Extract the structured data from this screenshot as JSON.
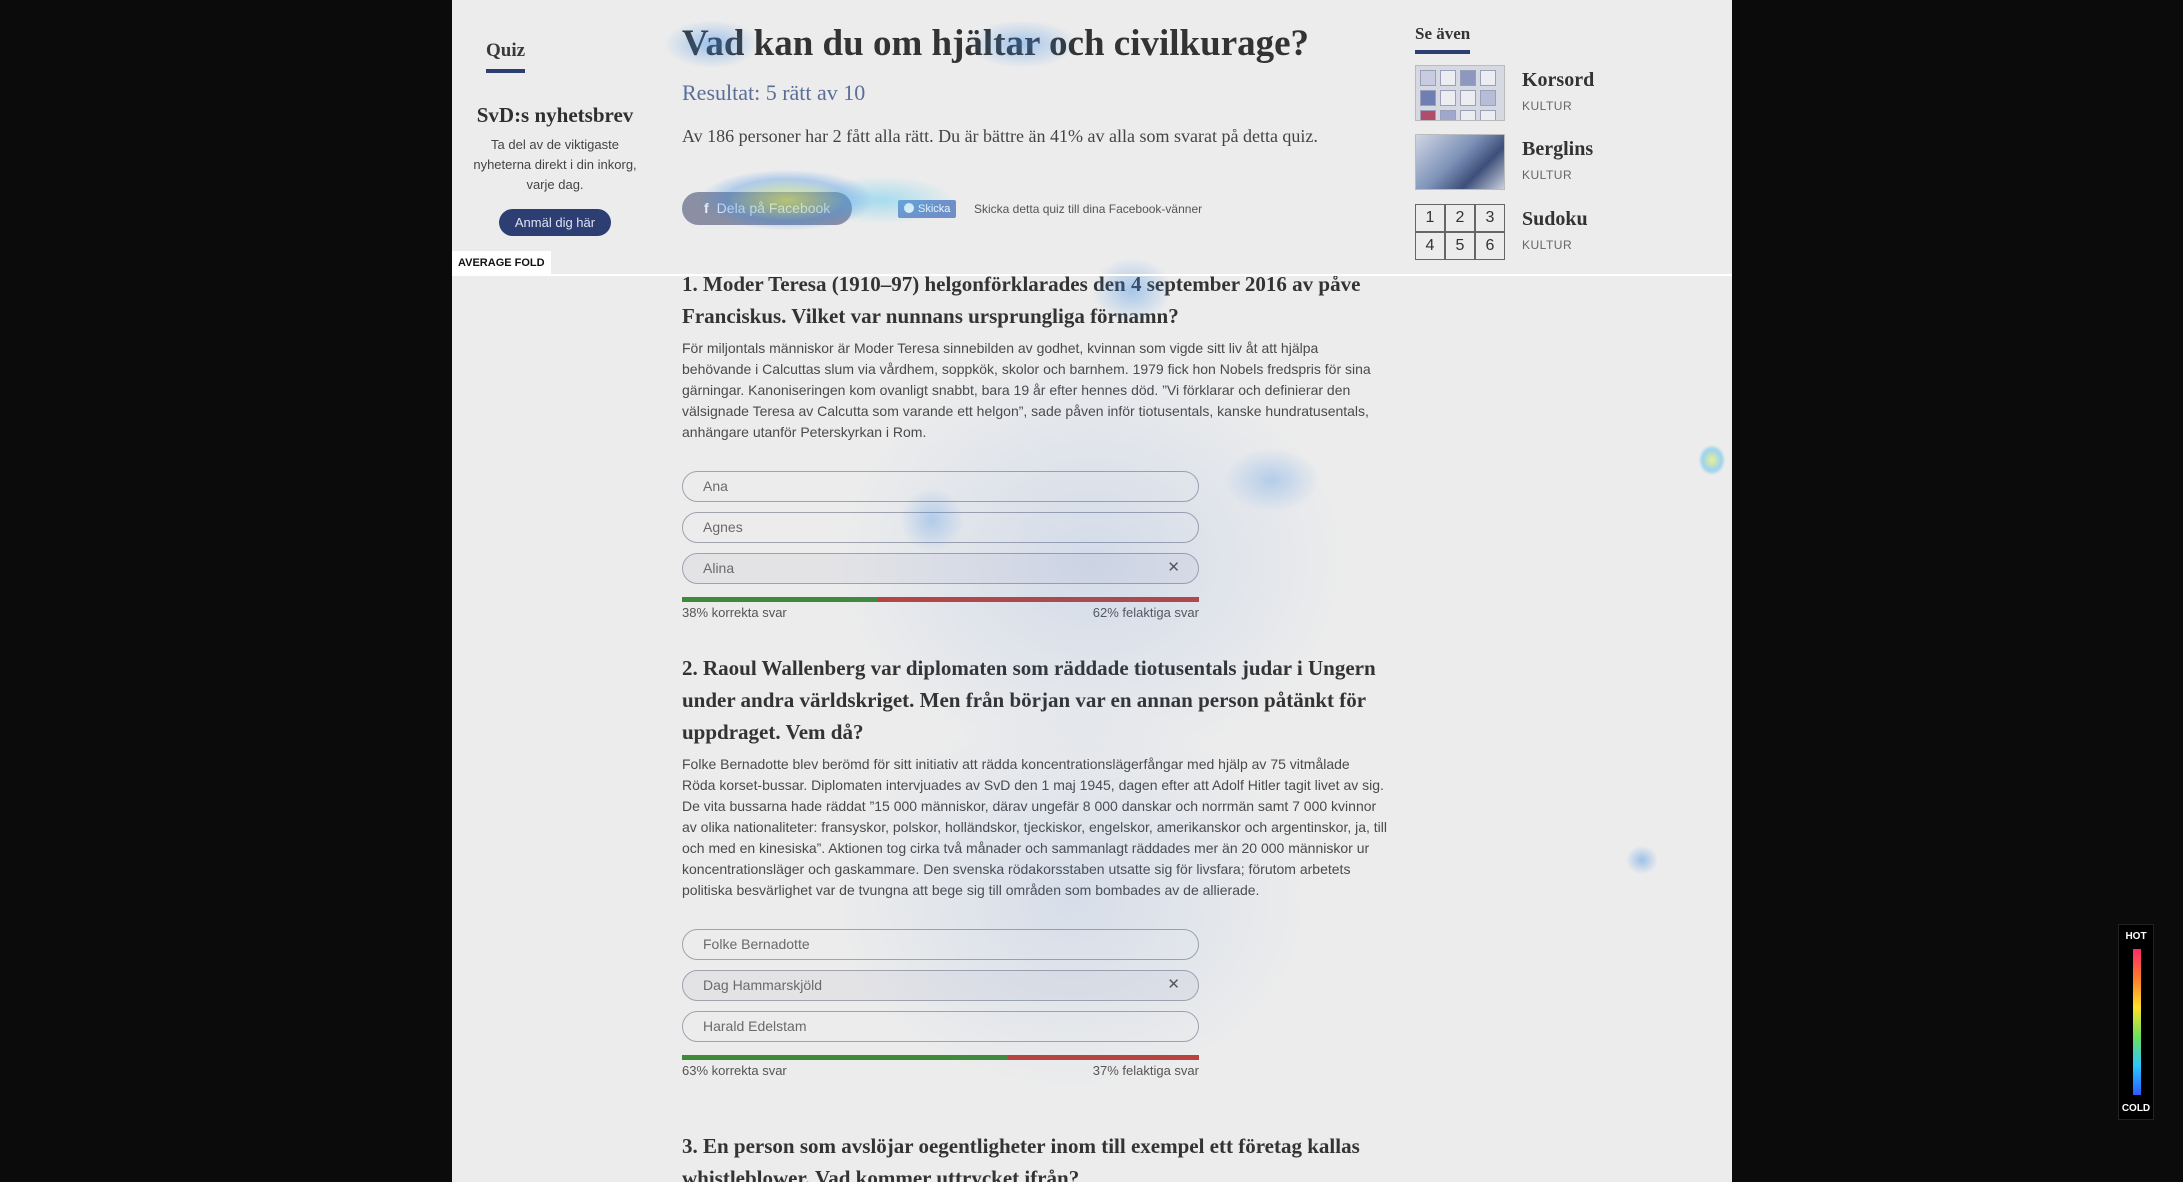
{
  "left": {
    "quiz_link": "Quiz",
    "newsletter": {
      "title": "SvD:s nyhetsbrev",
      "text": "Ta del av de viktigaste nyheterna direkt i din inkorg, varje dag.",
      "button": "Anmäl dig här"
    }
  },
  "main": {
    "title": "Vad kan du om hjältar och civilkurage?",
    "result": "Resultat: 5 rätt av 10",
    "summary": "Av 186 personer har 2 fått alla rätt. Du är bättre än 41% av alla som svarat på detta quiz.",
    "share": {
      "facebook_label": "Dela på Facebook",
      "facebook_icon": "f",
      "messenger_label": "Skicka",
      "messenger_text": "Skicka detta quiz till dina Facebook-vänner"
    },
    "questions": [
      {
        "title": "1. Moder Teresa (1910–97) helgonförklarades den 4 september 2016 av påve Franciskus. Vilket var nunnans ursprungliga förnamn?",
        "text": "För miljontals människor är Moder Teresa sinnebilden av godhet, kvinnan som vigde sitt liv åt att hjälpa behövande i Calcuttas slum via vårdhem, soppkök, skolor och barnhem. 1979 fick hon Nobels fredspris för sina gärningar. Kanoniseringen kom ovanligt snabbt, bara 19 år efter hennes död. ”Vi förklarar och definierar den välsignade Teresa av Calcutta som varande ett helgon”, sade påven inför tiotusentals, kanske hundratusentals, anhängare utanför Peterskyrkan i Rom.",
        "options": [
          "Ana",
          "Agnes",
          "Alina"
        ],
        "correct_pct": 38,
        "correct_label": "38% korrekta svar",
        "wrong_label": "62% felaktiga svar"
      },
      {
        "title": "2. Raoul Wallenberg var diplomaten som räddade tiotusentals judar i Ungern under andra världskriget. Men från början var en annan person påtänkt för uppdraget. Vem då?",
        "text": "Folke Bernadotte blev berömd för sitt initiativ att rädda koncentrationslägerfångar med hjälp av 75 vitmålade Röda korset-bussar. Diplomaten intervjuades av SvD den 1 maj 1945, dagen efter att Adolf Hitler tagit livet av sig. De vita bussarna hade räddat ”15 000 människor, därav ungefär 8 000 danskar och norrmän samt 7 000 kvinnor av olika nationaliteter: fransyskor, polskor, holländskor, tjeckiskor, engelskor, amerikanskor och argentinskor, ja, till och med en kinesiska”. Aktionen tog cirka två månader och sammanlagt räddades mer än 20 000 människor ur koncentrationsläger och gaskammare. Den svenska rödakorsstaben utsatte sig för livsfara; förutom arbetets politiska besvärlighet var de tvungna att bege sig till områden som bombades av de allierade.",
        "options": [
          "Folke Bernadotte",
          "Dag Hammarskjöld",
          "Harald Edelstam"
        ],
        "correct_pct": 63,
        "correct_label": "63% korrekta svar",
        "wrong_label": "37% felaktiga svar"
      },
      {
        "title": "3. En person som avslöjar oegentligheter inom till exempel ett företag kallas whistleblower. Vad kommer uttrycket ifrån?"
      }
    ]
  },
  "right": {
    "heading": "Se även",
    "items": [
      {
        "title": "Korsord",
        "tag": "KULTUR"
      },
      {
        "title": "Berglins",
        "tag": "KULTUR"
      },
      {
        "title": "Sudoku",
        "tag": "KULTUR"
      }
    ],
    "sudoku_digits": [
      "1",
      "2",
      "3",
      "4",
      "5",
      "6"
    ]
  },
  "overlay": {
    "fold_label": "AVERAGE FOLD",
    "legend_hot": "HOT",
    "legend_cold": "COLD"
  },
  "colors": {
    "accent": "#2c3e72",
    "correct_bar": "#3f8a3a",
    "wrong_bar": "#b8443f",
    "page_bg": "#ececec"
  }
}
